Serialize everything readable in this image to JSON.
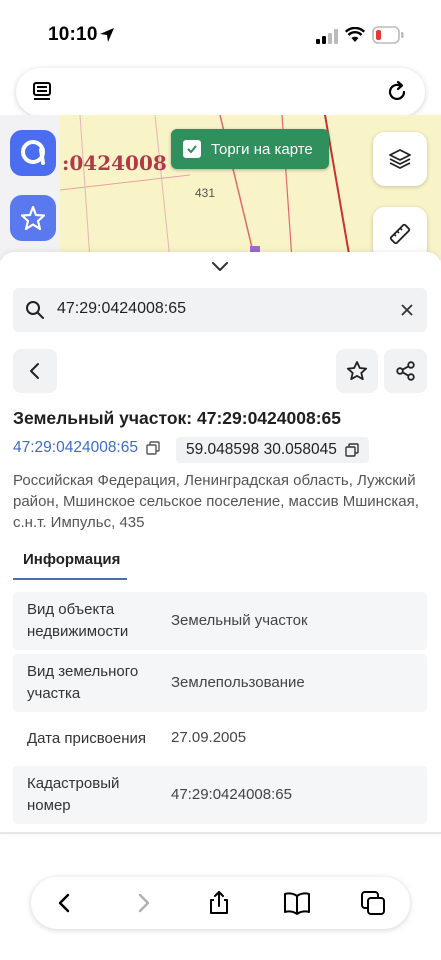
{
  "status_bar": {
    "time": "10:10"
  },
  "map": {
    "cadastral_label": ":0424008",
    "parcel_number": "431",
    "torgi_button": "Торги на карте"
  },
  "search": {
    "value": "47:29:0424008:65"
  },
  "object": {
    "title": "Земельный участок: 47:29:0424008:65",
    "kad_number": "47:29:0424008:65",
    "coordinates": "59.048598 30.058045",
    "address": "Российская Федерация, Ленинградская область, Лужский район, Мшинское сельское поселение, массив Мшинская, с.н.т. Импульс, 435"
  },
  "tabs": {
    "info": "Информация"
  },
  "info_rows": [
    {
      "label": "Вид объекта недвижимости",
      "value": "Земельный участок"
    },
    {
      "label": "Вид земельного участка",
      "value": "Землепользование"
    },
    {
      "label": "Дата присвоения",
      "value": "27.09.2005"
    },
    {
      "label": "Кадастровый номер",
      "value": "47:29:0424008:65"
    }
  ],
  "colors": {
    "accent": "#3d6cc9",
    "torgi_green": "#2f8f5d",
    "tab_underline": "#4c6fa7"
  }
}
